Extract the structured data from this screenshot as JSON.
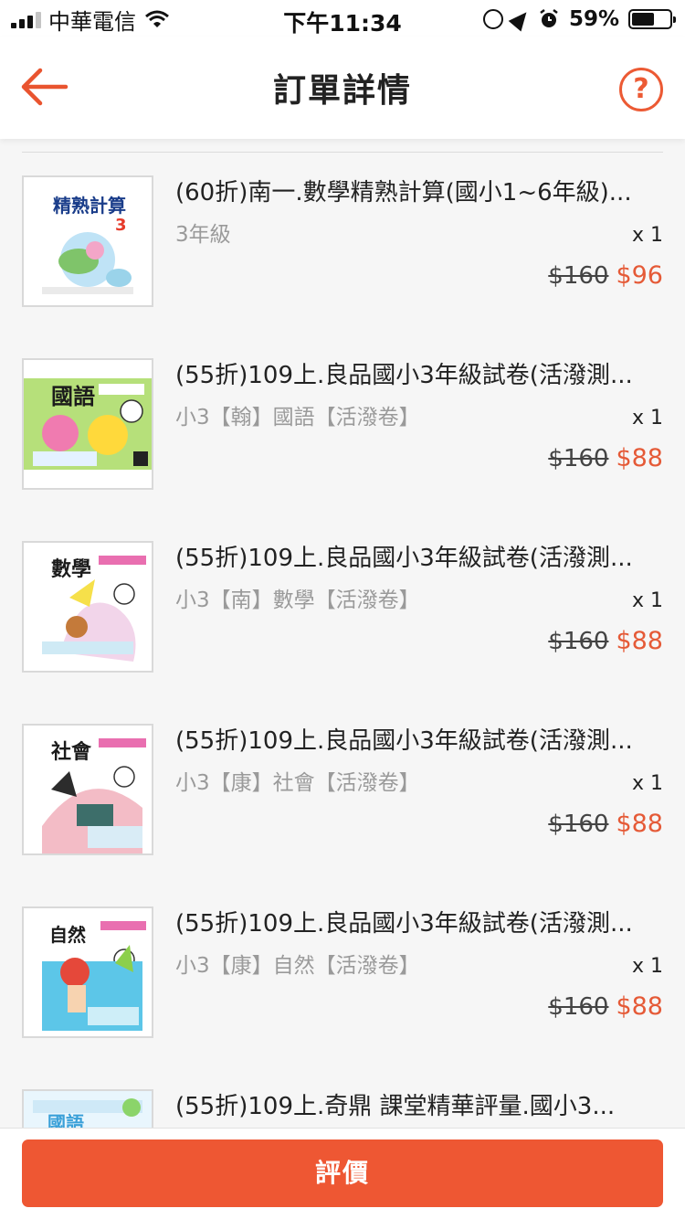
{
  "status_bar": {
    "carrier": "中華電信",
    "time": "下午11:34",
    "battery_percent": "59%",
    "battery_level": 0.59
  },
  "nav": {
    "title": "訂單詳情",
    "help_label": "?"
  },
  "items": [
    {
      "title": "(60折)南一.數學精熟計算(國小1~6年級)...",
      "variant": "3年級",
      "qty": "x 1",
      "price_old": "$160",
      "price_new": "$96",
      "cover_text": "精熟計算"
    },
    {
      "title": "(55折)109上.良品國小3年級試卷(活潑測...",
      "variant": "小3【翰】國語【活潑卷】",
      "qty": "x 1",
      "price_old": "$160",
      "price_new": "$88",
      "cover_text": "國語"
    },
    {
      "title": "(55折)109上.良品國小3年級試卷(活潑測...",
      "variant": "小3【南】數學【活潑卷】",
      "qty": "x 1",
      "price_old": "$160",
      "price_new": "$88",
      "cover_text": "數學"
    },
    {
      "title": "(55折)109上.良品國小3年級試卷(活潑測...",
      "variant": "小3【康】社會【活潑卷】",
      "qty": "x 1",
      "price_old": "$160",
      "price_new": "$88",
      "cover_text": "社會"
    },
    {
      "title": "(55折)109上.良品國小3年級試卷(活潑測...",
      "variant": "小3【康】自然【活潑卷】",
      "qty": "x 1",
      "price_old": "$160",
      "price_new": "$88",
      "cover_text": "自然"
    },
    {
      "title": "(55折)109上.奇鼎 課堂精華評量.國小3...",
      "variant": "",
      "qty": "",
      "price_old": "",
      "price_new": "",
      "cover_text": "國語"
    }
  ],
  "footer": {
    "review_label": "評價"
  },
  "colors": {
    "accent": "#ee5733",
    "price": "#e55a37"
  }
}
